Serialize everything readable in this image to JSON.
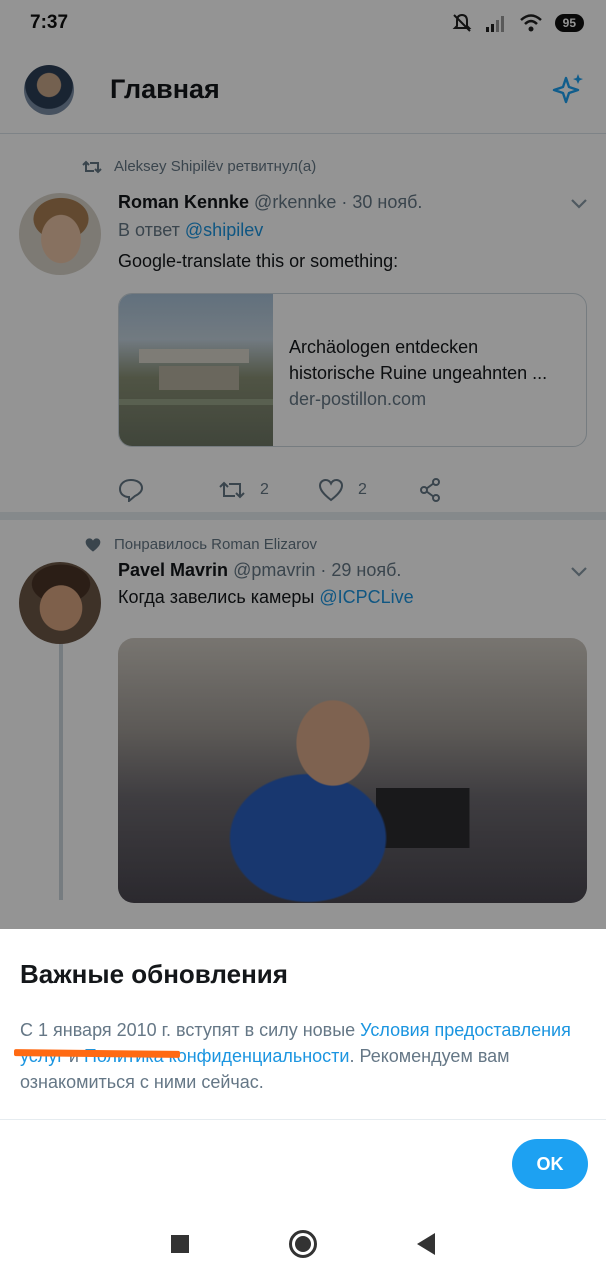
{
  "status_bar": {
    "time": "7:37",
    "battery": "95"
  },
  "header": {
    "title": "Главная"
  },
  "tweets": [
    {
      "context": "Aleksey Shipilёv ретвитнул(а)",
      "name": "Roman Kennke",
      "handle": "@rkennke",
      "date": "· 30 нояб.",
      "reply_prefix": "В ответ",
      "reply_to": "@shipilev",
      "text": "Google-translate this or something:",
      "card": {
        "title_line1": "Archäologen entdecken",
        "title_line2": "historische Ruine ungeahnten ...",
        "domain": "der-postillon.com"
      },
      "retweets": "2",
      "likes": "2"
    },
    {
      "context": "Понравилось Roman Elizarov",
      "name": "Pavel Mavrin",
      "handle": "@pmavrin",
      "date": "· 29 нояб.",
      "text": "Когда завелись камеры",
      "mention": "@ICPCLive"
    }
  ],
  "sheet": {
    "title": "Важные обновления",
    "text_part1": "С 1 января 2010 г. вступят в силу новые ",
    "link_terms": "Условия предоставления услуг",
    "text_part2": " и ",
    "link_privacy": "Политика конфиденциальности",
    "text_part3": ". Рекомендуем вам ознакомиться с ними сейчас.",
    "ok_label": "OK"
  },
  "colors": {
    "accent": "#1da1f2",
    "link": "#1b95e0",
    "highlight": "#ff6a13"
  }
}
